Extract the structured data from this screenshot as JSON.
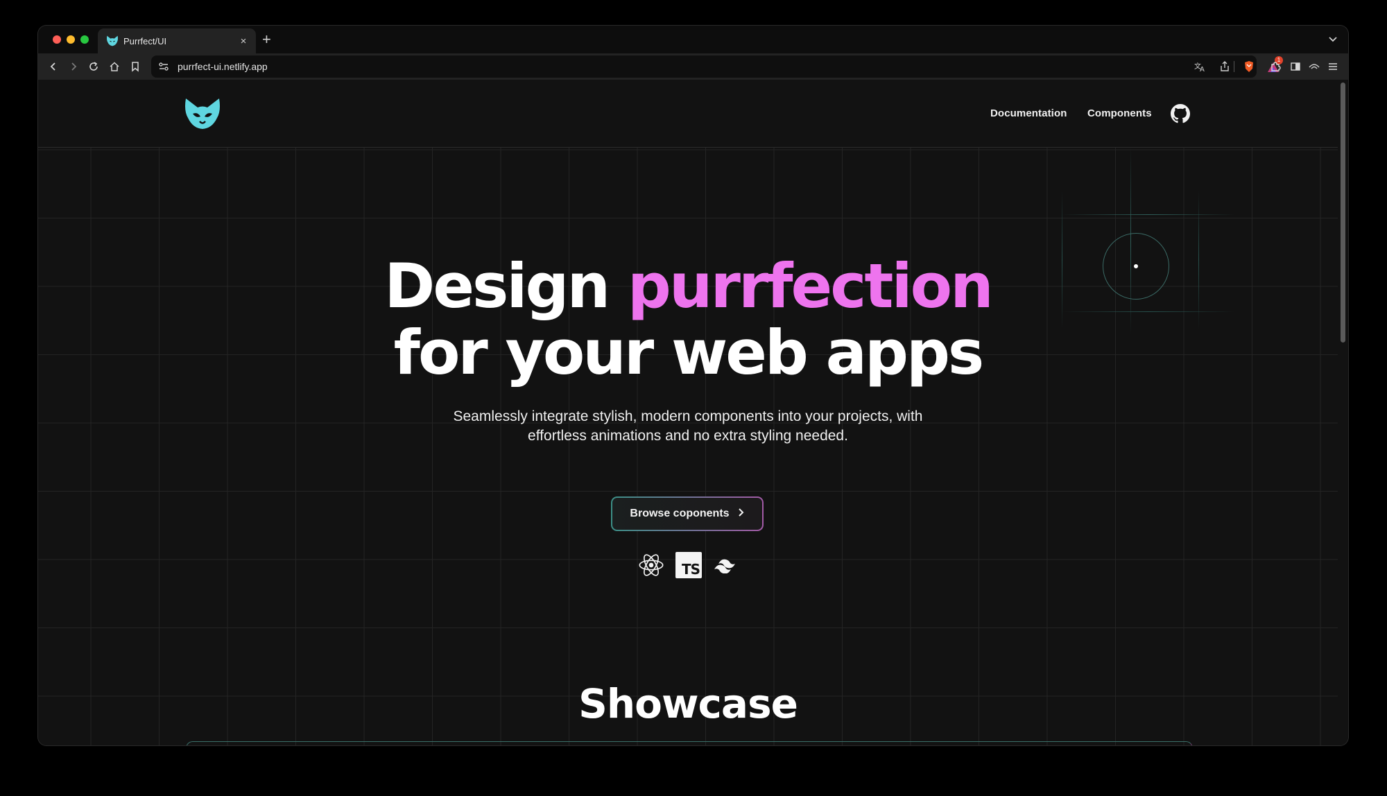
{
  "browser": {
    "tab_title": "Purrfect/UI",
    "tab_close": "×",
    "new_tab": "+",
    "url": "purrfect-ui.netlify.app",
    "notification_count": "1",
    "icons": [
      "back-icon",
      "forward-icon",
      "reload-icon",
      "home-icon",
      "bookmark-icon",
      "site-settings-icon",
      "translate-icon",
      "share-icon",
      "brave-shield-icon",
      "brave-rewards-icon",
      "extensions-icon",
      "sidebar-icon",
      "vpn-icon",
      "menu-icon"
    ]
  },
  "nav": {
    "logo": "cat-logo-icon",
    "documentation": "Documentation",
    "components": "Components",
    "github": "github-icon"
  },
  "hero": {
    "title_line1_plain": "Design",
    "title_line1_accent": "purrfection",
    "title_line2": "for your web apps",
    "subtitle_line1": "Seamlessly integrate stylish, modern components into your projects, with",
    "subtitle_line2": "effortless animations and no extra styling needed.",
    "cta_label": "Browse coponents",
    "tech_icons": [
      "react-icon",
      "typescript-icon",
      "tailwind-icon"
    ],
    "ts_label": "TS"
  },
  "showcase": {
    "heading": "Showcase"
  },
  "colors": {
    "accent": "#ee74ee",
    "logo": "#5fd6e0",
    "background": "#121212"
  }
}
